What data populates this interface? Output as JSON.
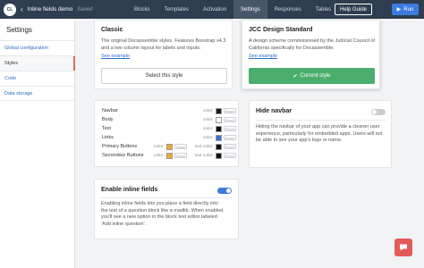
{
  "topbar": {
    "logo": "CL",
    "back_arrow": "‹",
    "app_name": "Inline fields demo",
    "saved": "Saved",
    "tabs": [
      "Blocks",
      "Templates",
      "Activation",
      "Settings",
      "Responses",
      "Tables"
    ],
    "active_tab": "Settings",
    "help_label": "Help Guide",
    "run_label": "Run",
    "run_icon": "▶"
  },
  "sidebar": {
    "title": "Settings",
    "items": [
      "Global configuration",
      "Styles",
      "Code",
      "Data storage"
    ],
    "active_item": "Styles"
  },
  "styles": {
    "classic": {
      "title": "Classic",
      "description": "The original Docassemble styles. Features Boostrap v4.3 and a two column layout for labels and inputs.",
      "link": "See example",
      "button": "Select this style"
    },
    "jcc": {
      "title": "JCC Design Standard",
      "description": "A design scheme commissioned by the Judicial Council of California specifically for Docassemble.",
      "link": "See example",
      "button": "Current style",
      "button_icon": "✔"
    }
  },
  "colors": {
    "color_label": "color:",
    "text_color_label": "text color:",
    "reset_label": "Reset",
    "rows": [
      {
        "name": "Navbar",
        "color": "#1a1a1a",
        "text_color": null
      },
      {
        "name": "Body",
        "color": "#ffffff",
        "text_color": null
      },
      {
        "name": "Text",
        "color": "#111111",
        "text_color": null
      },
      {
        "name": "Links",
        "color": "#3b6fd6",
        "text_color": null
      },
      {
        "name": "Primary Buttons",
        "color": "#f0a830",
        "text_color": "#111111"
      },
      {
        "name": "Secondary Buttons",
        "color": "#f0a830",
        "text_color": "#111111"
      }
    ]
  },
  "hide_navbar": {
    "title": "Hide navbar",
    "enabled": false,
    "description": "Hiding the navbar of your app can provide a cleaner user experience, particularly for embedded apps. Users will not be able to see your app's logo or name."
  },
  "inline_fields": {
    "title": "Enable inline fields",
    "enabled": true,
    "description": "Enabling inline fields lets you place a field directly into the text of a question block like a madlib. When enabled, you'll see a new option in the block text editor labeled 'Add inline question'."
  },
  "colors_theme": {
    "topbar_bg": "#2e3e50",
    "accent_blue": "#3b7be0",
    "green": "#4bae6c",
    "chat_red": "#e35b57"
  },
  "chat_icon": "chat-bubble-icon"
}
